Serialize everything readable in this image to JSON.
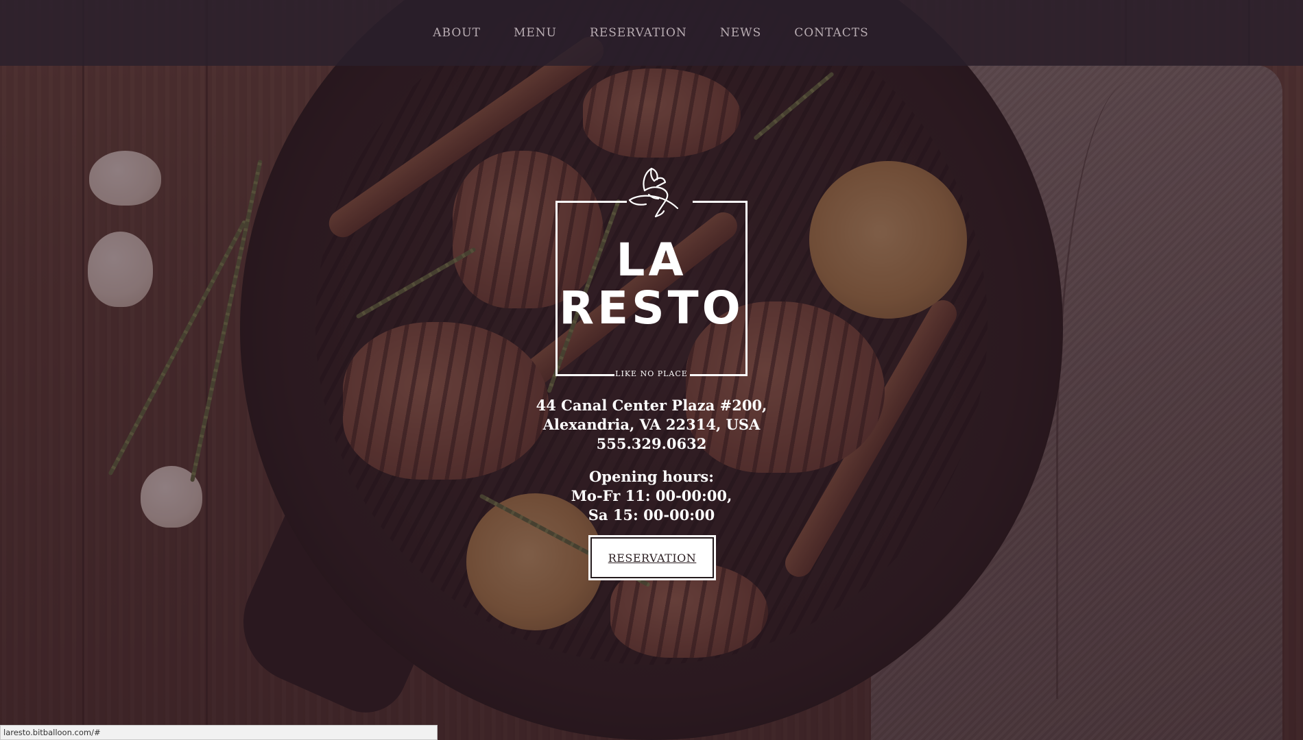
{
  "nav": {
    "items": [
      "ABOUT",
      "MENU",
      "RESERVATION",
      "NEWS",
      "CONTACTS"
    ]
  },
  "logo": {
    "line1": "LA",
    "line2": "RESTO",
    "tagline": "LIKE NO PLACE"
  },
  "address": {
    "line1": "44 Canal Center Plaza #200,",
    "line2": "Alexandria, VA 22314, USA",
    "phone": "555.329.0632"
  },
  "hours": {
    "title": "Opening hours:",
    "weekdays": "Mo-Fr 11: 00-00:00,",
    "saturday": "Sa 15: 00-00:00"
  },
  "cta": {
    "label": "RESERVATION"
  },
  "status_bar": {
    "url": "laresto.bitballoon.com/#"
  },
  "colors": {
    "overlay": "#341c28",
    "nav_bg": "#2a202c",
    "nav_text": "#b9adb3",
    "text": "#ffffff"
  },
  "icons": {
    "crest": "lobster-crest-icon"
  }
}
